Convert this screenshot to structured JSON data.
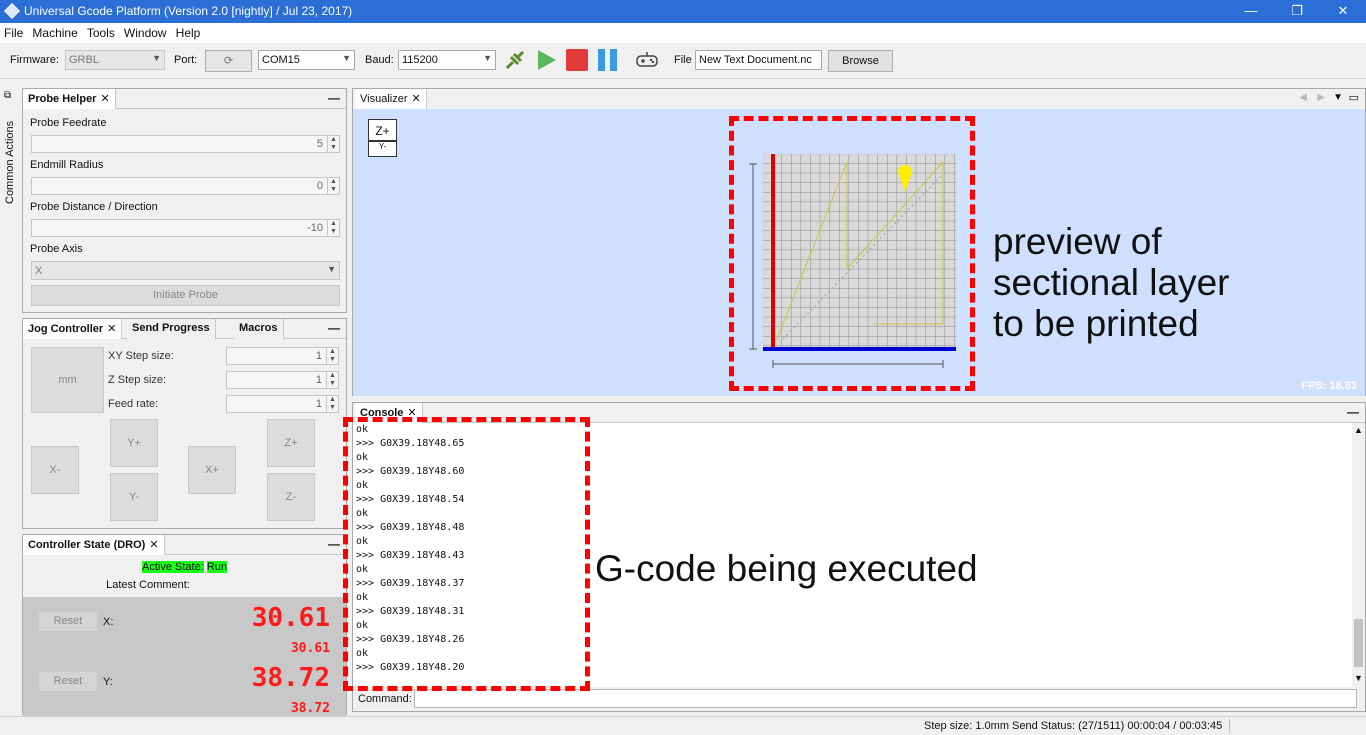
{
  "window": {
    "title": "Universal Gcode Platform (Version 2.0 [nightly]  / Jul 23, 2017)",
    "minimize": "—",
    "restore": "❐",
    "close": "✕"
  },
  "menu": [
    "File",
    "Machine",
    "Tools",
    "Window",
    "Help"
  ],
  "toolbar": {
    "firmware_label": "Firmware:",
    "firmware_value": "GRBL",
    "port_label": "Port:",
    "port_value": "COM15",
    "baud_label": "Baud:",
    "baud_value": "115200",
    "file_label": "File",
    "file_value": "New Text Document.nc",
    "browse": "Browse"
  },
  "sidebar": {
    "common_actions": "Common Actions"
  },
  "probe": {
    "tab": "Probe Helper",
    "feedrate_label": "Probe Feedrate",
    "feedrate": "5",
    "endmill_label": "Endmill Radius",
    "endmill": "0",
    "distance_label": "Probe Distance / Direction",
    "distance": "-10",
    "axis_label": "Probe Axis",
    "axis": "X",
    "initiate": "Initiate Probe"
  },
  "jog": {
    "tabs": [
      "Jog Controller",
      "Send Progress",
      "Macros"
    ],
    "units": "mm",
    "xy_label": "XY Step size:",
    "xy": "1",
    "z_label": "Z Step size:",
    "z": "1",
    "feed_label": "Feed rate:",
    "feed": "1",
    "buttons": {
      "yplus": "Y+",
      "yminus": "Y-",
      "xminus": "X-",
      "xplus": "X+",
      "zplus": "Z+",
      "zminus": "Z-"
    }
  },
  "dro": {
    "tab": "Controller State (DRO)",
    "active_label": "Active State:",
    "active_value": "Run",
    "latest_comment": "Latest Comment:",
    "reset": "Reset",
    "x_label": "X:",
    "x_value": "30.61",
    "x_machine": "30.61",
    "y_label": "Y:",
    "y_value": "38.72",
    "y_machine": "38.72"
  },
  "visualizer": {
    "tab": "Visualizer",
    "zplus": "Z+",
    "yminus": "Y-",
    "fps": "FPS: 18.83",
    "annotation": [
      "preview of",
      "sectional layer",
      "to be printed"
    ]
  },
  "console": {
    "tab": "Console",
    "lines": [
      "ok",
      ">>> G0X39.18Y48.65",
      "ok",
      ">>> G0X39.18Y48.60",
      "ok",
      ">>> G0X39.18Y48.54",
      "ok",
      ">>> G0X39.18Y48.48",
      "ok",
      ">>> G0X39.18Y48.43",
      "ok",
      ">>> G0X39.18Y48.37",
      "ok",
      ">>> G0X39.18Y48.31",
      "ok",
      ">>> G0X39.18Y48.26",
      "ok",
      ">>> G0X39.18Y48.20"
    ],
    "annotation": "G-code being executed",
    "command_label": "Command:"
  },
  "status": "Step size: 1.0mm Send Status: (27/1511) 00:00:04 / 00:03:45",
  "colors": {
    "active_green": "#1aff1a",
    "dro_red": "#ff1a1a",
    "annotation_red": "#ff0000",
    "visualizer_bg": "#cfe0ff"
  }
}
